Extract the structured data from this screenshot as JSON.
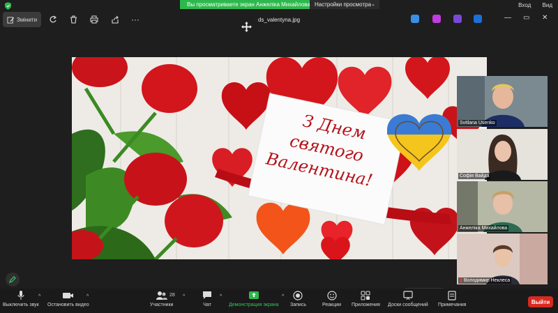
{
  "banner": {
    "sharing_text": "Вы просматриваете экран Анжеліка Михайлова",
    "view_settings": "Настройки просмотра",
    "sign_in": "Вход",
    "view": "Вид"
  },
  "toolbar": {
    "edit_label": "Змінити",
    "file_name": "ds_valentyna.jpg"
  },
  "slide": {
    "card_line1": "З Днем",
    "card_line2": "святого",
    "card_line3": "Валентина!"
  },
  "participants": [
    {
      "name": "Svitlana Usenko"
    },
    {
      "name": "Софія Вайда"
    },
    {
      "name": "Анжеліка Михайлова"
    },
    {
      "name": "Володимир Неклеса"
    }
  ],
  "bottom_bar": {
    "mute": "Выключить звук",
    "stop_video": "Остановить видео",
    "participants": "Участники",
    "participants_count": "28",
    "chat": "Чат",
    "share": "Демонстрация экрана",
    "record": "Запись",
    "reactions": "Реакции",
    "apps": "Приложения",
    "whiteboards": "Доски сообщений",
    "notes": "Примечания",
    "leave": "Выйти"
  },
  "colors": {
    "share_green": "#2db84d",
    "leave_red": "#d72a20",
    "background": "#1e1e1e"
  }
}
